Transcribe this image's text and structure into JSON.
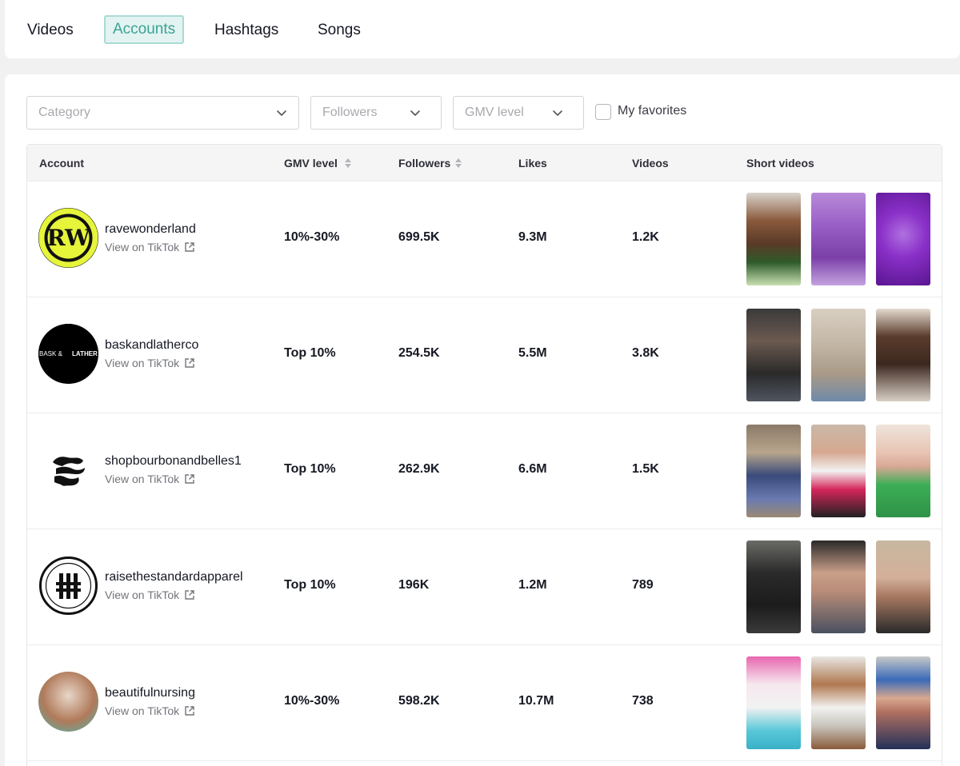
{
  "tabs": [
    {
      "label": "Videos",
      "active": false
    },
    {
      "label": "Accounts",
      "active": true
    },
    {
      "label": "Hashtags",
      "active": false
    },
    {
      "label": "Songs",
      "active": false
    }
  ],
  "filters": {
    "category": "Category",
    "followers": "Followers",
    "gmv_level": "GMV level",
    "favorites_label": "My favorites",
    "favorites_checked": false
  },
  "columns": {
    "account": "Account",
    "gmv": "GMV level",
    "followers": "Followers",
    "likes": "Likes",
    "videos": "Videos",
    "short_videos": "Short videos"
  },
  "rows": [
    {
      "account": "ravewonderland",
      "link": "View on TikTok",
      "gmv": "10%-30%",
      "followers": "699.5K",
      "likes": "9.3M",
      "videos": "1.2K"
    },
    {
      "account": "baskandlatherco",
      "link": "View on TikTok",
      "gmv": "Top 10%",
      "followers": "254.5K",
      "likes": "5.5M",
      "videos": "3.8K"
    },
    {
      "account": "shopbourbonandbelles1",
      "link": "View on TikTok",
      "gmv": "Top 10%",
      "followers": "262.9K",
      "likes": "6.6M",
      "videos": "1.5K"
    },
    {
      "account": "raisethestandardapparel",
      "link": "View on TikTok",
      "gmv": "Top 10%",
      "followers": "196K",
      "likes": "1.2M",
      "videos": "789"
    },
    {
      "account": "beautifulnursing",
      "link": "View on TikTok",
      "gmv": "10%-30%",
      "followers": "598.2K",
      "likes": "10.7M",
      "videos": "738"
    }
  ],
  "logos": {
    "rave": "RW",
    "bask_left": "BASK &",
    "bask_right": "LATHER"
  },
  "colors": {
    "accent": "#3aa394",
    "active_tab_bg": "#e3f3f1",
    "rave_logo_yellow": "#e6f43a"
  },
  "icons": {
    "dropdown": "chevron-down-icon",
    "sort": "sort-arrows-icon",
    "external": "external-link-icon"
  }
}
